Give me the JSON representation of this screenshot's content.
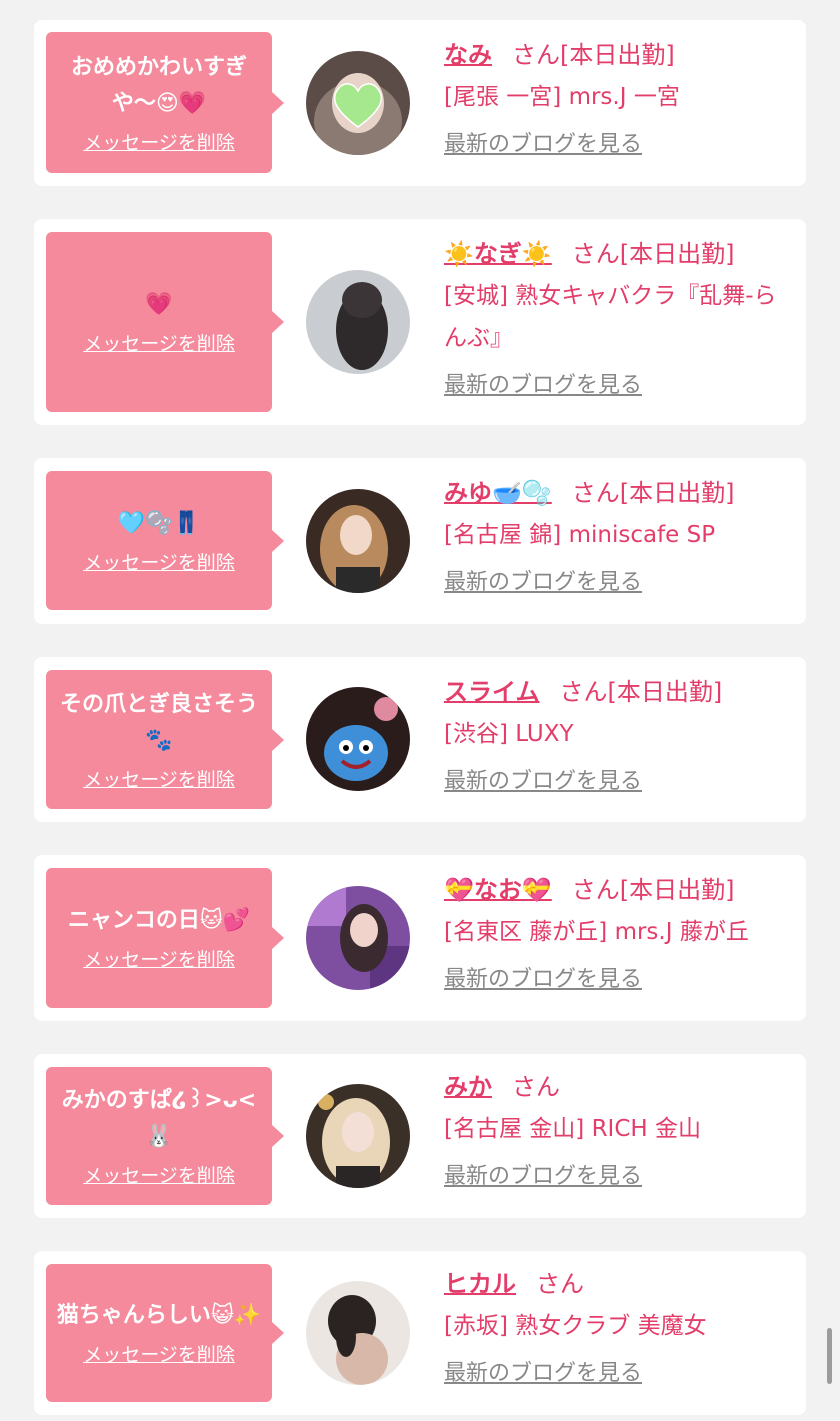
{
  "colors": {
    "accent": "#e33d6a",
    "bubble": "#f48a9c",
    "background": "#f2f2f2",
    "link_gray": "#888888"
  },
  "entries": [
    {
      "message": "おめめかわいすぎや〜😍💗",
      "delete_label": "メッセージを削除",
      "name": "なみ",
      "honorific": "さん",
      "status": "[本日出勤]",
      "shop": "[尾張 一宮] mrs.J 一宮",
      "blog_label": "最新のブログを見る"
    },
    {
      "message": "💗",
      "delete_label": "メッセージを削除",
      "name": "☀️なぎ☀️",
      "honorific": "さん",
      "status": "[本日出勤]",
      "shop": "[安城] 熟女キャバクラ『乱舞-らんぶ』",
      "blog_label": "最新のブログを見る"
    },
    {
      "message": "🩵🫧👖",
      "delete_label": "メッセージを削除",
      "name": "みゆ🥣🫧",
      "honorific": "さん",
      "status": "[本日出勤]",
      "shop": "[名古屋 錦] miniscafe SP",
      "blog_label": "最新のブログを見る"
    },
    {
      "message": "その爪とぎ良さそう🐾",
      "delete_label": "メッセージを削除",
      "name": "スライム",
      "honorific": "さん",
      "status": "[本日出勤]",
      "shop": "[渋谷] LUXY",
      "blog_label": "最新のブログを見る"
    },
    {
      "message": "ニャンコの日🐱💕",
      "delete_label": "メッセージを削除",
      "name": "💝なお💝",
      "honorific": "さん",
      "status": "[本日出勤]",
      "shop": "[名東区 藤が丘] mrs.J 藤が丘",
      "blog_label": "最新のブログを見る"
    },
    {
      "message": "みかのすぱ໒꒱>ᴗ<🐰",
      "delete_label": "メッセージを削除",
      "name": "みか",
      "honorific": "さん",
      "status": "",
      "shop": "[名古屋 金山] RICH 金山",
      "blog_label": "最新のブログを見る"
    },
    {
      "message": "猫ちゃんらしい😺✨",
      "delete_label": "メッセージを削除",
      "name": "ヒカル",
      "honorific": "さん",
      "status": "",
      "shop": "[赤坂] 熟女クラブ 美魔女",
      "blog_label": "最新のブログを見る"
    }
  ]
}
